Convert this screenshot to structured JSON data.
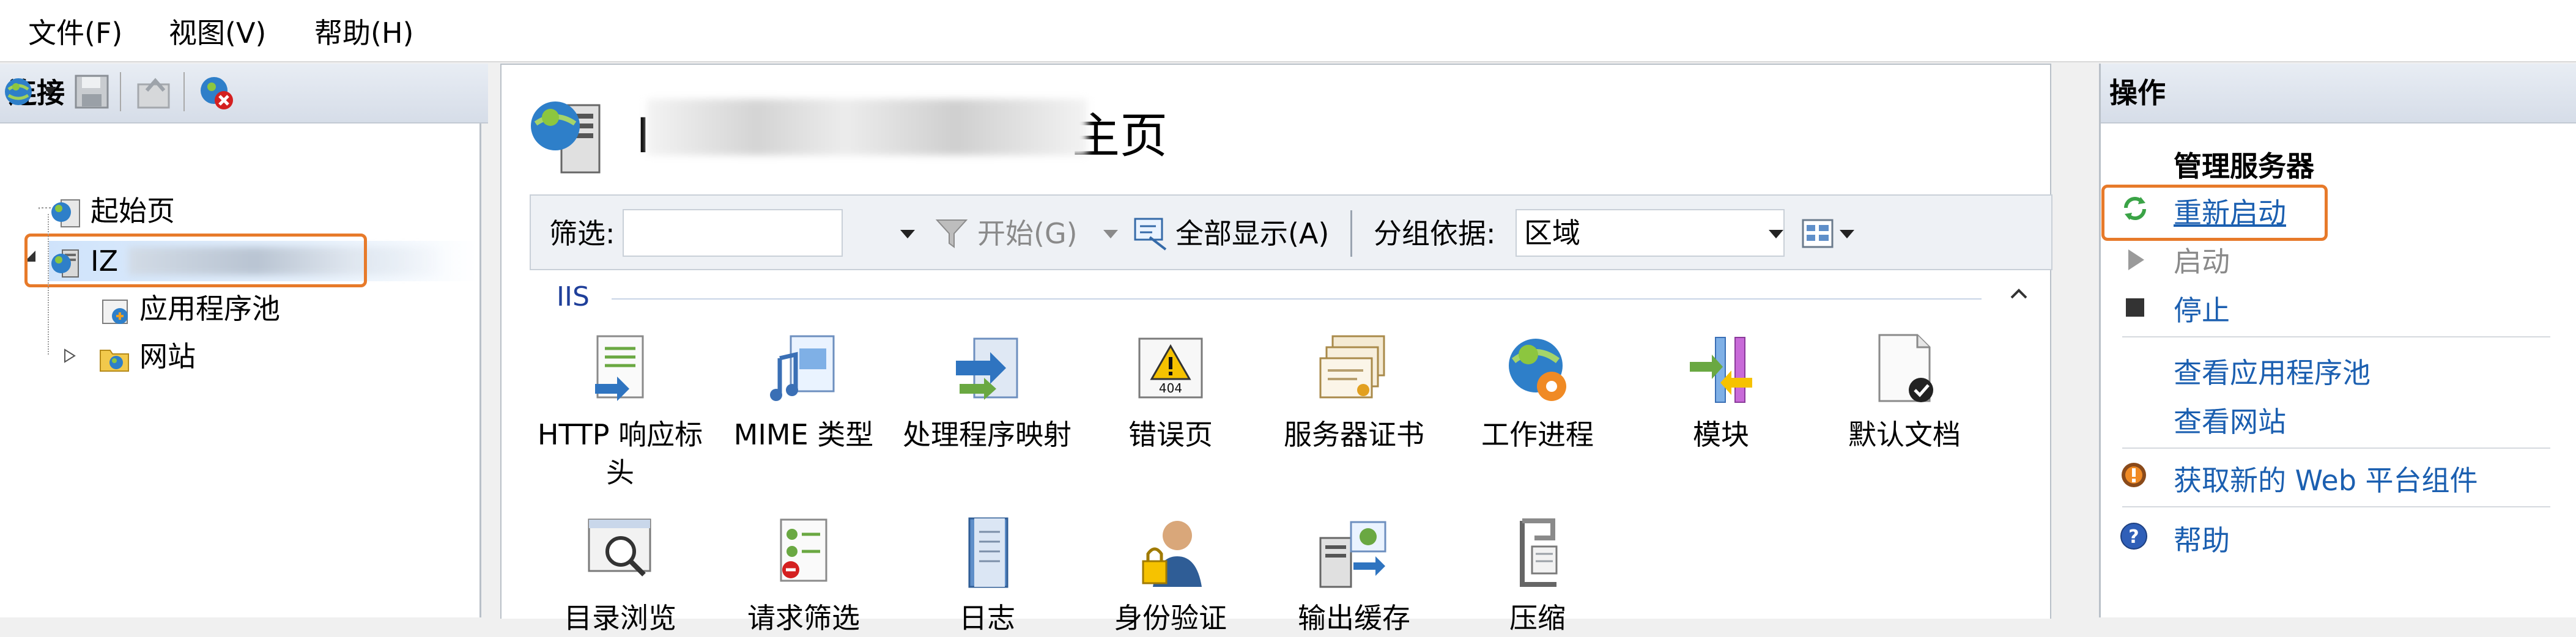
{
  "menu": {
    "file": "文件(F)",
    "view": "视图(V)",
    "help": "帮助(H)"
  },
  "connections": {
    "title": "连接",
    "tree": {
      "start_page": "起始页",
      "server_prefix": "IZ",
      "app_pools": "应用程序池",
      "sites": "网站"
    }
  },
  "center": {
    "title_prefix": "I",
    "title_suffix": "主页",
    "filter_label": "筛选:",
    "start_label": "开始(G)",
    "show_all_label": "全部显示(A)",
    "group_by_label": "分组依据:",
    "group_by_value": "区域",
    "section_iis": "IIS",
    "features": [
      {
        "label": "HTTP 响应标头",
        "icon": "http-response-headers-icon"
      },
      {
        "label": "MIME 类型",
        "icon": "mime-types-icon"
      },
      {
        "label": "处理程序映射",
        "icon": "handler-mappings-icon"
      },
      {
        "label": "错误页",
        "icon": "error-pages-icon"
      },
      {
        "label": "服务器证书",
        "icon": "server-certificates-icon"
      },
      {
        "label": "工作进程",
        "icon": "worker-processes-icon"
      },
      {
        "label": "模块",
        "icon": "modules-icon"
      },
      {
        "label": "默认文档",
        "icon": "default-document-icon"
      }
    ],
    "features_row2": [
      {
        "label": "目录浏览",
        "icon": "directory-browsing-icon"
      },
      {
        "label": "请求筛选",
        "icon": "request-filtering-icon"
      },
      {
        "label": "日志",
        "icon": "logging-icon"
      },
      {
        "label": "身份验证",
        "icon": "authentication-icon"
      },
      {
        "label": "输出缓存",
        "icon": "output-caching-icon"
      },
      {
        "label": "压缩",
        "icon": "compression-icon"
      }
    ]
  },
  "actions": {
    "title": "操作",
    "manage_server": "管理服务器",
    "restart": "重新启动",
    "start": "启动",
    "stop": "停止",
    "view_app_pools": "查看应用程序池",
    "view_sites": "查看网站",
    "get_web_platform": "获取新的 Web 平台组件",
    "help": "帮助"
  },
  "colors": {
    "accent_orange": "#e77a2a",
    "link_blue": "#1b5fb0"
  }
}
